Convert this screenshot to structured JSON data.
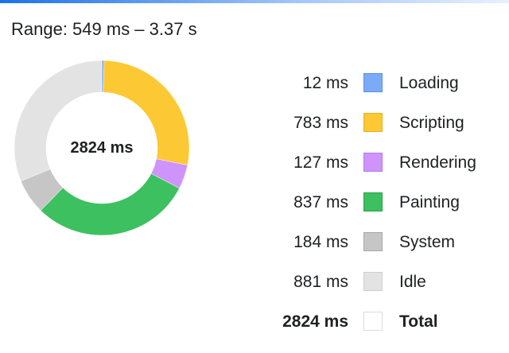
{
  "range": {
    "text": "Range: 549 ms – 3.37 s"
  },
  "summary": {
    "total_label": "2824 ms"
  },
  "chart_data": {
    "type": "pie",
    "title": "",
    "total": 2824,
    "unit": "ms",
    "slices": [
      {
        "category": "Loading",
        "value": 12,
        "color": "#7baaf7",
        "border": "#5b8fe6"
      },
      {
        "category": "Scripting",
        "value": 783,
        "color": "#fcc934",
        "border": "#e6b21f"
      },
      {
        "category": "Rendering",
        "value": 127,
        "color": "#cf94fb",
        "border": "#b679ea"
      },
      {
        "category": "Painting",
        "value": 837,
        "color": "#3dc05f",
        "border": "#2ba24b"
      },
      {
        "category": "System",
        "value": 184,
        "color": "#c6c6c6",
        "border": "#a8a8a8"
      },
      {
        "category": "Idle",
        "value": 881,
        "color": "#e3e3e3",
        "border": "#cfcfcf"
      }
    ]
  },
  "legend": {
    "rows": [
      {
        "value": "12 ms",
        "label": "Loading"
      },
      {
        "value": "783 ms",
        "label": "Scripting"
      },
      {
        "value": "127 ms",
        "label": "Rendering"
      },
      {
        "value": "837 ms",
        "label": "Painting"
      },
      {
        "value": "184 ms",
        "label": "System"
      },
      {
        "value": "881 ms",
        "label": "Idle"
      },
      {
        "value": "2824 ms",
        "label": "Total"
      }
    ],
    "total_swatch_color": "#ffffff",
    "total_swatch_border": "#dadce0"
  }
}
